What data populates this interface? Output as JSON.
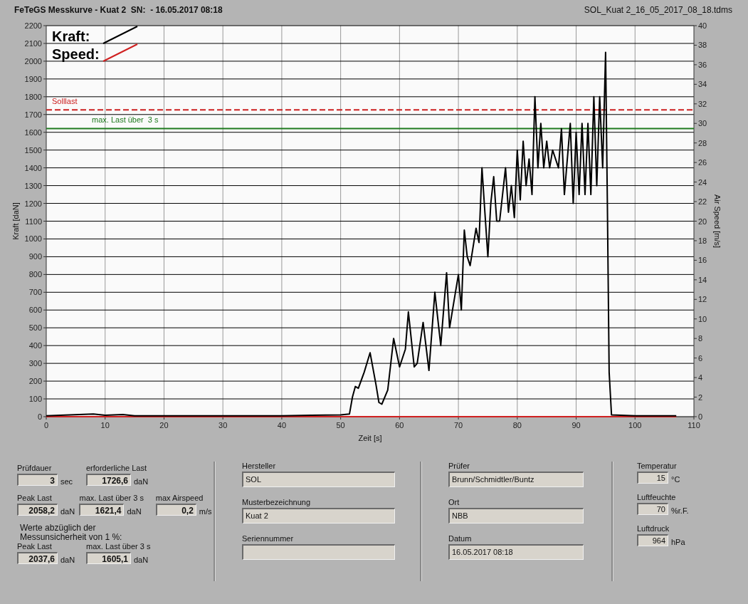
{
  "header": {
    "title": "FeTeGS Messkurve - Kuat 2  SN:  - 16.05.2017 08:18",
    "file": "SOL_Kuat 2_16_05_2017_08_18.tdms"
  },
  "chart": {
    "chart_data": {
      "type": "line",
      "xlabel": "Zeit [s]",
      "ylabel": "Kraft [daN]",
      "y2label": "Air Speed [m/s]",
      "xlim": [
        0,
        110
      ],
      "ylim": [
        0,
        2200
      ],
      "y2lim": [
        0,
        40
      ],
      "xticks": [
        0,
        10,
        20,
        30,
        40,
        50,
        60,
        70,
        80,
        90,
        100,
        110
      ],
      "yticks": [
        0,
        100,
        200,
        300,
        400,
        500,
        600,
        700,
        800,
        900,
        1000,
        1100,
        1200,
        1300,
        1400,
        1500,
        1600,
        1700,
        1800,
        1900,
        2000,
        2100,
        2200
      ],
      "y2ticks": [
        0,
        2,
        4,
        6,
        8,
        10,
        12,
        14,
        16,
        18,
        20,
        22,
        24,
        26,
        28,
        30,
        32,
        34,
        36,
        38,
        40
      ],
      "x": [
        0,
        8,
        10,
        13,
        15,
        20,
        30,
        40,
        45,
        50,
        51.5,
        52,
        52.5,
        53,
        54,
        55,
        56,
        56.5,
        57,
        58,
        59,
        60,
        61,
        61.5,
        62.5,
        63,
        64,
        65,
        66,
        67,
        68,
        68.5,
        69,
        70,
        70.5,
        71,
        71.5,
        72,
        73,
        73.5,
        74,
        74.5,
        75,
        75.5,
        76,
        76.5,
        77,
        78,
        78.5,
        79,
        79.5,
        80,
        80.5,
        81,
        81.5,
        82,
        82.5,
        83,
        83.5,
        84,
        84.5,
        85,
        85.5,
        86,
        87,
        87.5,
        88,
        89,
        89.5,
        90,
        90.5,
        91,
        91.5,
        92,
        92.5,
        93,
        93.5,
        94,
        94.5,
        95,
        95.3,
        95.6,
        96,
        100,
        107
      ],
      "series": [
        {
          "name": "Kraft:",
          "color": "#000000",
          "values": [
            5,
            15,
            8,
            12,
            5,
            5,
            5,
            5,
            8,
            10,
            15,
            110,
            170,
            160,
            250,
            360,
            180,
            80,
            70,
            150,
            440,
            280,
            380,
            590,
            280,
            300,
            530,
            260,
            700,
            400,
            810,
            500,
            600,
            800,
            600,
            1050,
            900,
            850,
            1060,
            980,
            1400,
            1150,
            900,
            1200,
            1350,
            1100,
            1100,
            1400,
            1150,
            1300,
            1120,
            1500,
            1220,
            1550,
            1300,
            1450,
            1250,
            1800,
            1400,
            1650,
            1400,
            1550,
            1400,
            1500,
            1400,
            1620,
            1250,
            1650,
            1200,
            1600,
            1250,
            1650,
            1250,
            1650,
            1250,
            1800,
            1300,
            1800,
            1400,
            2050,
            1200,
            250,
            10,
            5,
            5
          ]
        },
        {
          "name": "Speed:",
          "color": "#d02020",
          "values": [
            0,
            0,
            0,
            0,
            0,
            0,
            0,
            0,
            0,
            0,
            0,
            0,
            0,
            0,
            0,
            0,
            0,
            0,
            0,
            0,
            0,
            0,
            0,
            0,
            0,
            0,
            0,
            0,
            0,
            0,
            0,
            0,
            0,
            0,
            0,
            0,
            0,
            0,
            0,
            0,
            0,
            0,
            0,
            0,
            0,
            0,
            0,
            0,
            0,
            0,
            0,
            0,
            0,
            0,
            0,
            0,
            0,
            0,
            0,
            0,
            0,
            0,
            0,
            0,
            0,
            0,
            0,
            0,
            0,
            0,
            0,
            0,
            0,
            0,
            0,
            0,
            0,
            0,
            0,
            0,
            0,
            0,
            0,
            0,
            0
          ]
        }
      ],
      "ref_lines": [
        {
          "axis": "y",
          "value": 1726.6,
          "label": "Solllast",
          "color": "#cc2020"
        },
        {
          "axis": "y",
          "value": 1621.4,
          "label": "max. Last über  3 s",
          "color": "#1e7a1e"
        }
      ],
      "grid": true,
      "legend": true
    }
  },
  "results": {
    "rows": [
      [
        {
          "label": "Prüfdauer",
          "value": "3",
          "unit": "sec"
        },
        {
          "label": "erforderliche Last",
          "value": "1726,6",
          "unit": "daN"
        }
      ],
      [
        {
          "label": "Peak Last",
          "value": "2058,2",
          "unit": "daN"
        },
        {
          "label": "max. Last über  3 s",
          "value": "1621,4",
          "unit": "daN"
        },
        {
          "label": "max Airspeed",
          "value": "0,2",
          "unit": "m/s"
        }
      ]
    ],
    "note": "Werte abzüglich der\nMessunsicherheit von 1  %:",
    "corrected": [
      {
        "label": "Peak Last",
        "value": "2037,6",
        "unit": "daN"
      },
      {
        "label": "max. Last über  3 s",
        "value": "1605,1",
        "unit": "daN"
      }
    ]
  },
  "info": [
    [
      {
        "label": "Hersteller",
        "value": "SOL"
      },
      {
        "label": "Musterbezeichnung",
        "value": "Kuat 2"
      },
      {
        "label": "Seriennummer"
      }
    ],
    [
      {
        "label": "Prüfer",
        "value": "Brunn/Schmidtler/Buntz"
      },
      {
        "label": "Ort",
        "value": "NBB"
      },
      {
        "label": "Datum",
        "value": "16.05.2017 08:18"
      }
    ]
  ],
  "environment": [
    {
      "label": "Temperatur",
      "value": "15",
      "unit": "°C"
    },
    {
      "label": "Luftfeuchte",
      "value": "70",
      "unit": "%r.F."
    },
    {
      "label": "Luftdruck",
      "value": "964",
      "unit": "hPa"
    }
  ]
}
